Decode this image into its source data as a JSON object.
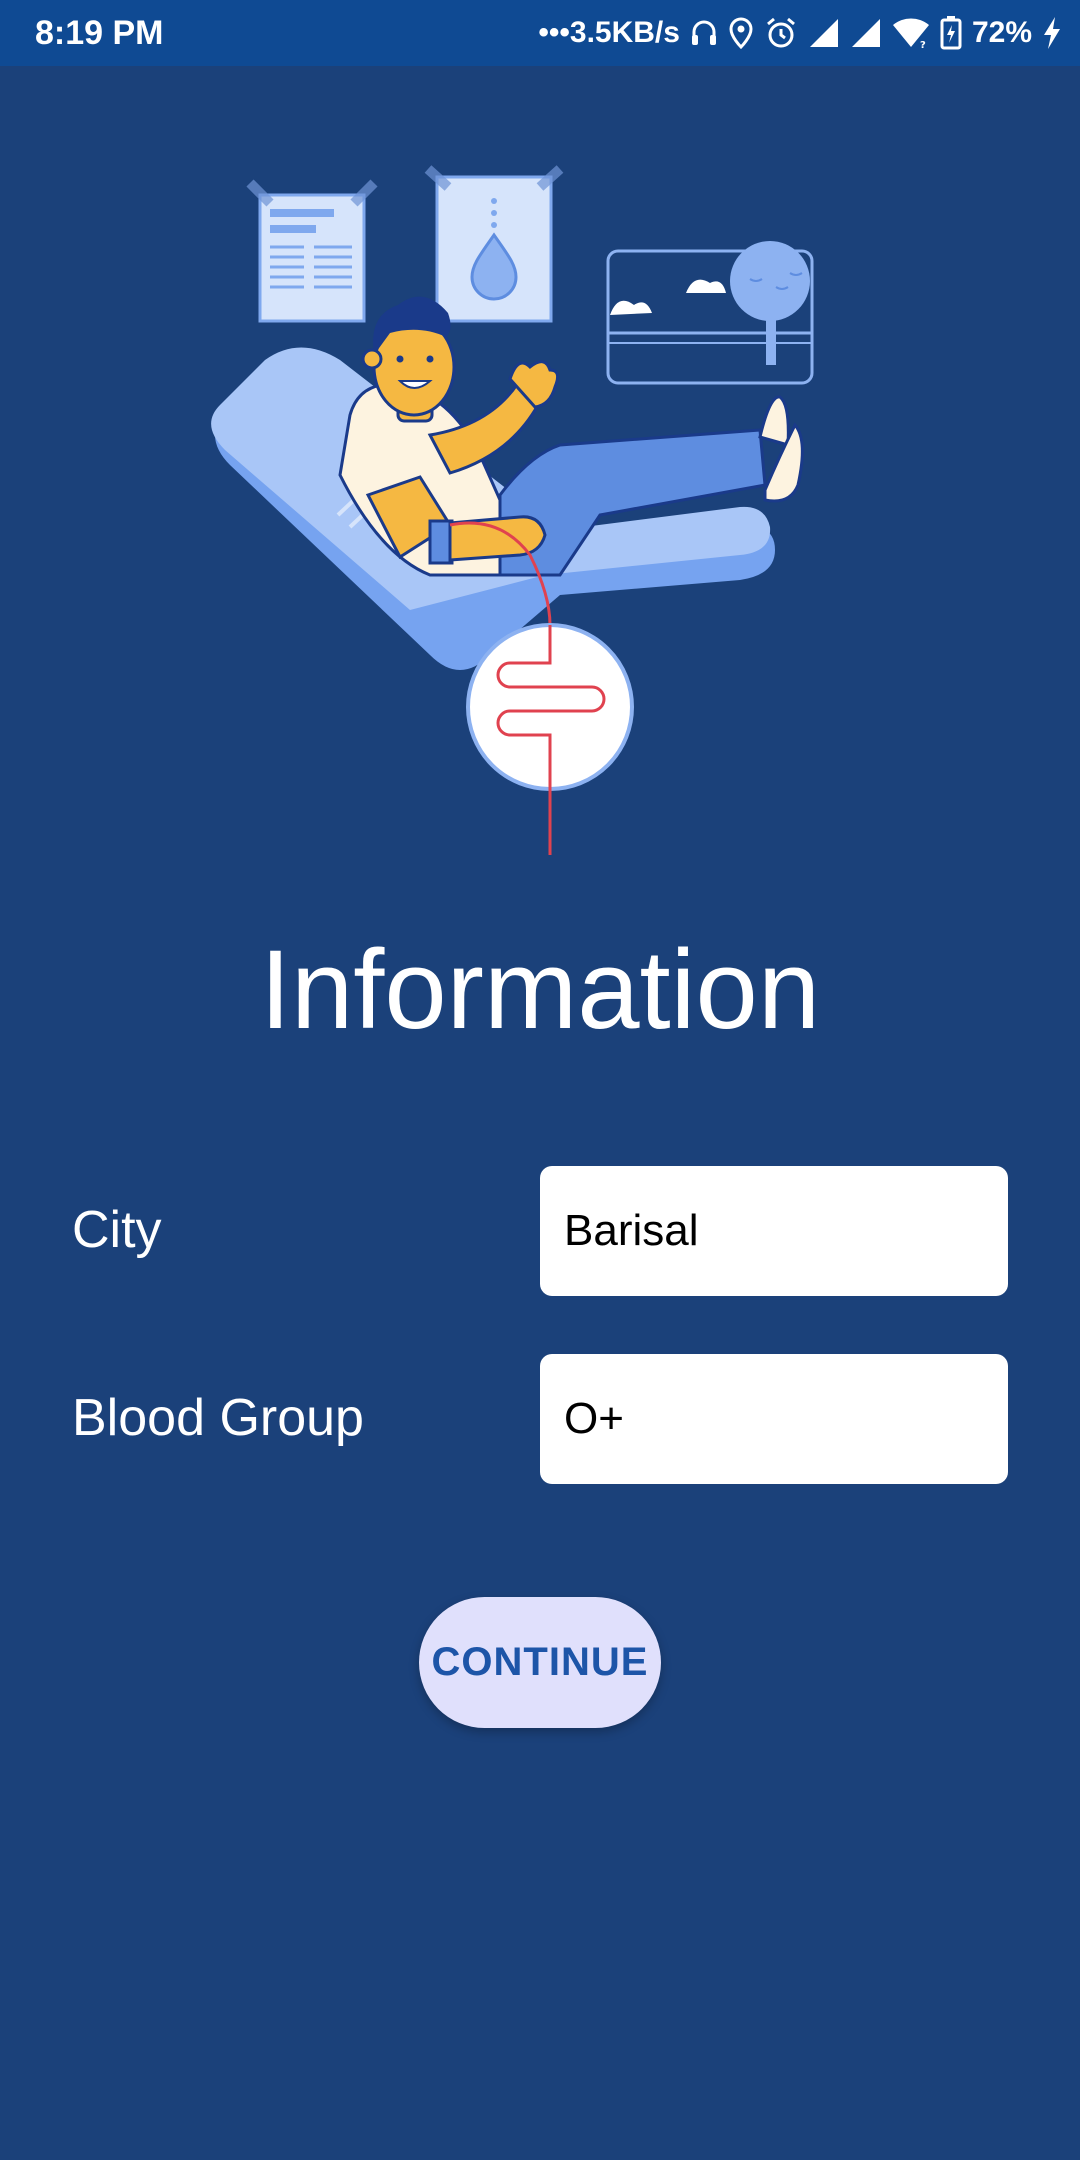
{
  "status_bar": {
    "time": "8:19 PM",
    "network_speed": "•••3.5KB/s",
    "battery_percent": "72%",
    "icons": [
      "headphones-icon",
      "location-icon",
      "alarm-icon",
      "signal-icon",
      "signal-icon",
      "wifi-icon",
      "battery-charging-icon",
      "charging-bolt-icon"
    ]
  },
  "illustration": {
    "name": "blood-donation-illustration"
  },
  "page": {
    "title": "Information"
  },
  "form": {
    "city": {
      "label": "City",
      "value": "Barisal"
    },
    "blood_group": {
      "label": "Blood Group",
      "value": "O+"
    },
    "continue_label": "CONTINUE"
  },
  "colors": {
    "background": "#1B417A",
    "status_bar": "#0F4A93",
    "button_bg": "#E0E0FC",
    "button_text": "#1D55A8"
  }
}
